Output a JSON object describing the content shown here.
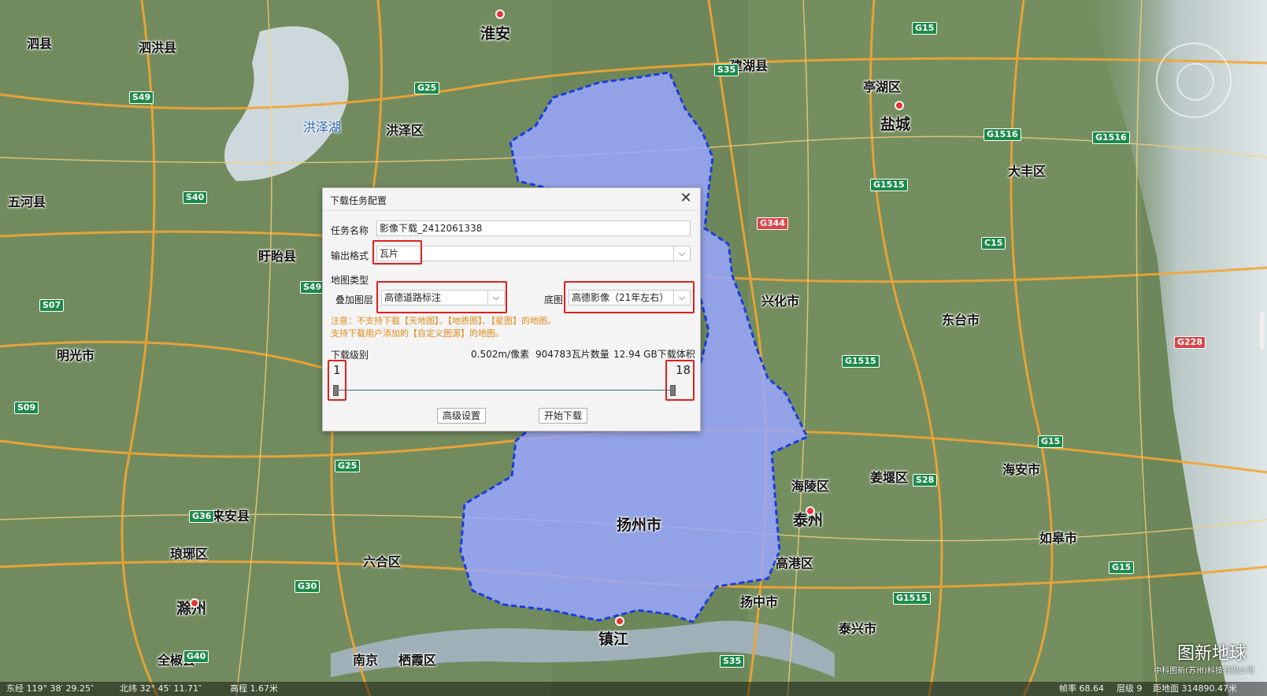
{
  "map": {
    "labels": [
      {
        "text": "泗县",
        "cls": "lbl"
      },
      {
        "text": "泗洪县",
        "cls": "lbl"
      },
      {
        "text": "淮安",
        "cls": "lbl big"
      },
      {
        "text": "建湖县",
        "cls": "lbl"
      },
      {
        "text": "亭湖区",
        "cls": "lbl"
      },
      {
        "text": "盐城",
        "cls": "lbl big"
      },
      {
        "text": "洪泽湖",
        "cls": "lbl water"
      },
      {
        "text": "洪泽区",
        "cls": "lbl"
      },
      {
        "text": "大丰区",
        "cls": "lbl"
      },
      {
        "text": "五河县",
        "cls": "lbl"
      },
      {
        "text": "盱眙县",
        "cls": "lbl"
      },
      {
        "text": "兴化市",
        "cls": "lbl"
      },
      {
        "text": "东台市",
        "cls": "lbl"
      },
      {
        "text": "明光市",
        "cls": "lbl"
      },
      {
        "text": "海陵区",
        "cls": "lbl"
      },
      {
        "text": "姜堰区",
        "cls": "lbl"
      },
      {
        "text": "海安市",
        "cls": "lbl"
      },
      {
        "text": "扬州市",
        "cls": "lbl big"
      },
      {
        "text": "泰州",
        "cls": "lbl big"
      },
      {
        "text": "来安县",
        "cls": "lbl"
      },
      {
        "text": "琅琊区",
        "cls": "lbl"
      },
      {
        "text": "六合区",
        "cls": "lbl"
      },
      {
        "text": "滁州",
        "cls": "lbl big"
      },
      {
        "text": "高港区",
        "cls": "lbl"
      },
      {
        "text": "如皋市",
        "cls": "lbl"
      },
      {
        "text": "扬中市",
        "cls": "lbl"
      },
      {
        "text": "镇江",
        "cls": "lbl big"
      },
      {
        "text": "泰兴市",
        "cls": "lbl"
      },
      {
        "text": "南京",
        "cls": "lbl"
      },
      {
        "text": "栖霞区",
        "cls": "lbl"
      },
      {
        "text": "全椒县",
        "cls": "lbl"
      }
    ],
    "shields": [
      {
        "text": "G15",
        "red": false
      },
      {
        "text": "G25",
        "red": false
      },
      {
        "text": "S49",
        "red": false
      },
      {
        "text": "S35",
        "red": false
      },
      {
        "text": "G1516",
        "red": false
      },
      {
        "text": "G1516",
        "red": false
      },
      {
        "text": "G1515",
        "red": false
      },
      {
        "text": "G344",
        "red": true
      },
      {
        "text": "S40",
        "red": false
      },
      {
        "text": "C15",
        "red": false
      },
      {
        "text": "S49",
        "red": false
      },
      {
        "text": "S07",
        "red": false
      },
      {
        "text": "G1515",
        "red": false
      },
      {
        "text": "G228",
        "red": true
      },
      {
        "text": "S09",
        "red": false
      },
      {
        "text": "G15",
        "red": false
      },
      {
        "text": "G25",
        "red": false
      },
      {
        "text": "G36",
        "red": false
      },
      {
        "text": "S28",
        "red": false
      },
      {
        "text": "G30",
        "red": false
      },
      {
        "text": "G1515",
        "red": false
      },
      {
        "text": "G15",
        "red": false
      },
      {
        "text": "S35",
        "red": false
      },
      {
        "text": "G40",
        "red": false
      }
    ]
  },
  "dialog": {
    "title": "下载任务配置",
    "close": "✕",
    "task_name_label": "任务名称",
    "task_name_value": "影像下载_2412061338",
    "output_format_label": "输出格式",
    "output_format_value": "瓦片",
    "map_type_label": "地图类型",
    "overlay_label": "叠加图层",
    "overlay_value": "高德道路标注",
    "base_label": "底图",
    "base_value": "高德影像（21年左右）",
    "notice_1": "注意：不支持下载【天地图】、【地质图】、【星图】的地图。",
    "notice_2": "支持下载用户添加的【自定义图源】的地图。",
    "level_label": "下载级别",
    "stat_resolution": "0.502m/像素",
    "stat_tiles": "904783瓦片数量",
    "stat_size": "12.94 GB下载体积",
    "level_min": "1",
    "level_max": "18",
    "level_range": [
      1,
      18
    ],
    "advanced_button": "高级设置",
    "start_button": "开始下载",
    "dropdown_arrow": "⌵"
  },
  "status": {
    "lon": "东经 119° 38′ 29.25″",
    "lat": "北纬 32° 45′ 11.71″",
    "elev": "高程 1.67米",
    "fps": "帧率 68.64",
    "level": "层级 9",
    "dist": "距地面 314890.47米"
  },
  "brand": {
    "name": "图新地球",
    "sub": "中科图新(苏州)科技有限公司"
  },
  "colors": {
    "highlight": "#e0201c",
    "region_fill": "#9aa7ff",
    "region_border": "#1a3de0",
    "notice": "#e38a1a"
  }
}
